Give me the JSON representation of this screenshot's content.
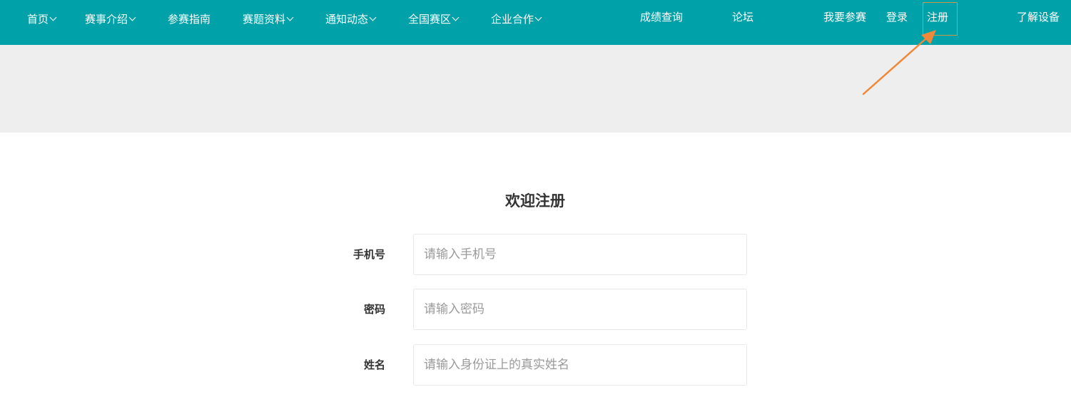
{
  "nav": {
    "items": [
      {
        "label": "首页",
        "has_dropdown": true
      },
      {
        "label": "赛事介绍",
        "has_dropdown": true
      },
      {
        "label": "参赛指南",
        "has_dropdown": false
      },
      {
        "label": "赛题资料",
        "has_dropdown": true
      },
      {
        "label": "通知动态",
        "has_dropdown": true
      },
      {
        "label": "全国赛区",
        "has_dropdown": true
      },
      {
        "label": "企业合作",
        "has_dropdown": true
      }
    ],
    "score_query": "成绩查询",
    "forum": "论坛",
    "join": "我要参赛",
    "login": "登录",
    "register": "注册",
    "equipment": "了解设备"
  },
  "form": {
    "title": "欢迎注册",
    "fields": [
      {
        "label": "手机号",
        "placeholder": "请输入手机号"
      },
      {
        "label": "密码",
        "placeholder": "请输入密码"
      },
      {
        "label": "姓名",
        "placeholder": "请输入身份证上的真实姓名"
      }
    ]
  },
  "colors": {
    "nav_background": "#00a1a8",
    "banner_background": "#eeeeee",
    "annotation_arrow": "#f0883a",
    "highlight_box": "#c49a47"
  }
}
